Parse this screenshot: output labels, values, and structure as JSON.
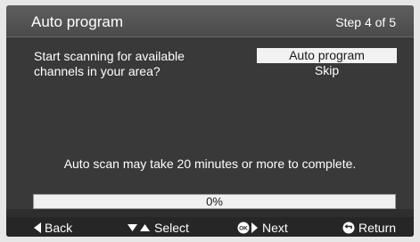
{
  "header": {
    "title": "Auto program",
    "step": "Step 4 of 5"
  },
  "main": {
    "question": "Start scanning for available channels in your area?",
    "options": [
      {
        "label": "Auto program",
        "selected": true
      },
      {
        "label": "Skip",
        "selected": false
      }
    ],
    "note": "Auto scan may take 20 minutes or more to complete.",
    "progress": {
      "value": 0,
      "label": "0%"
    }
  },
  "footer": {
    "back": {
      "label": "Back",
      "icon": "left-arrow-icon"
    },
    "select": {
      "label": "Select",
      "icon": "up-down-arrows-icon"
    },
    "next": {
      "label": "Next",
      "icon": "ok-right-arrow-icon"
    },
    "return": {
      "label": "Return",
      "icon": "return-icon"
    }
  }
}
